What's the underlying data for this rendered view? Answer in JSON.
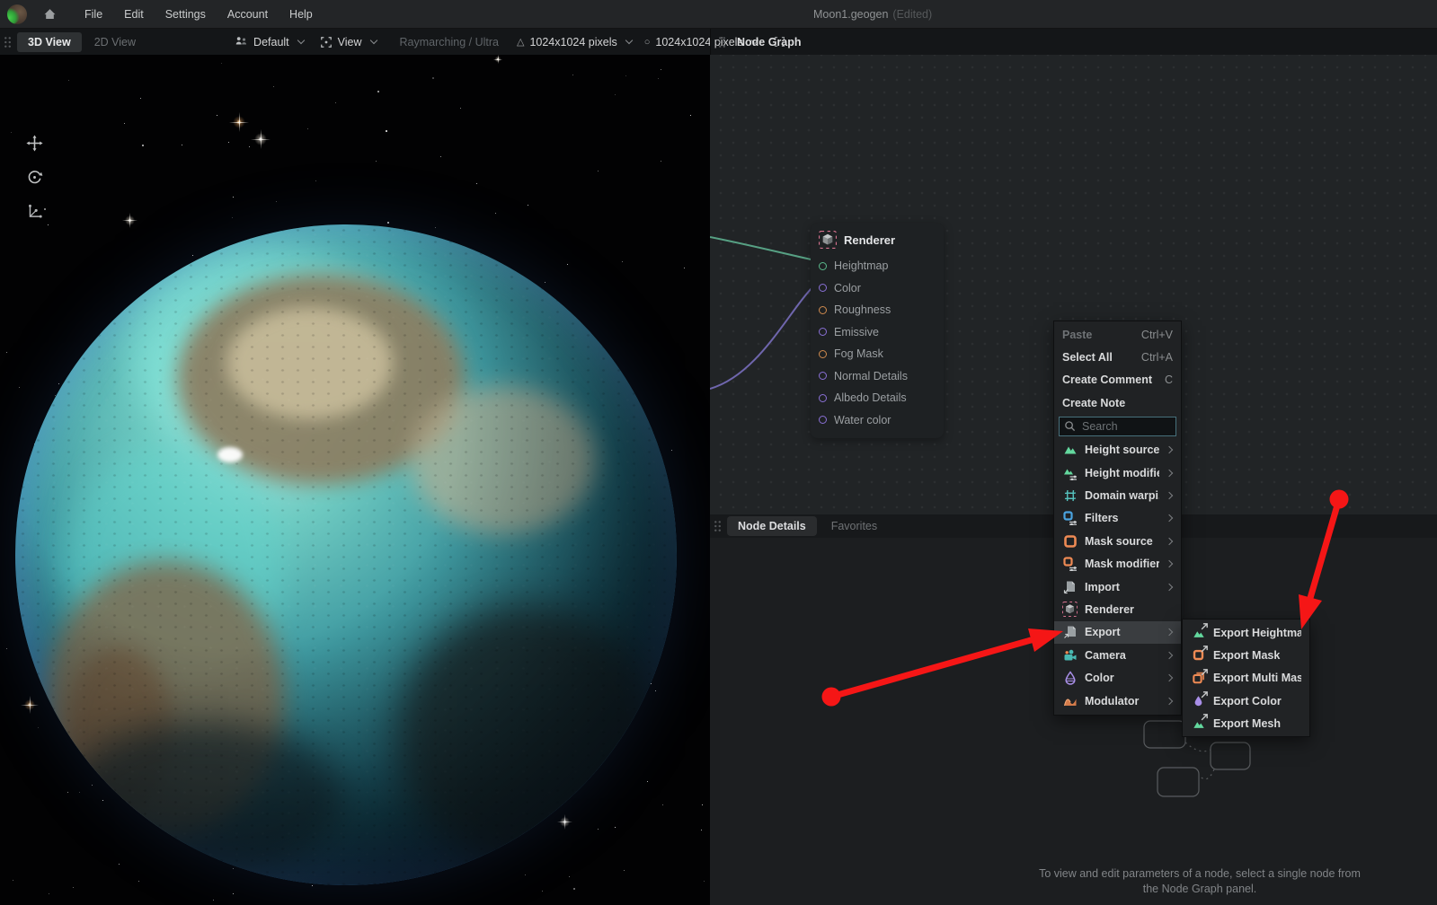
{
  "window": {
    "app_title": "Moon1.geogen",
    "edited_suffix": "(Edited)"
  },
  "menubar": {
    "items": [
      "File",
      "Edit",
      "Settings",
      "Account",
      "Help"
    ]
  },
  "toolbar": {
    "tabs": [
      {
        "label": "3D View"
      },
      {
        "label": "2D View"
      }
    ],
    "preset": "Default",
    "view": "View",
    "render_mode": "Raymarching / Ultra",
    "heightmap_resolution": "1024x1024 pixels",
    "texture_resolution": "1024x1024 pixels",
    "node_graph_title": "Node Graph"
  },
  "renderer_node": {
    "title": "Renderer",
    "ports": [
      {
        "label": "Heightmap",
        "color": "#5ab98b"
      },
      {
        "label": "Color",
        "color": "#8a70d6"
      },
      {
        "label": "Roughness",
        "color": "#cf8a4e"
      },
      {
        "label": "Emissive",
        "color": "#8a70d6"
      },
      {
        "label": "Fog Mask",
        "color": "#cf8a4e"
      },
      {
        "label": "Normal Details",
        "color": "#8a70d6"
      },
      {
        "label": "Albedo Details",
        "color": "#8a70d6"
      },
      {
        "label": "Water color",
        "color": "#8a70d6"
      }
    ]
  },
  "context_menu": {
    "actions": [
      {
        "label": "Paste",
        "shortcut": "Ctrl+V",
        "disabled": true
      },
      {
        "label": "Select All",
        "shortcut": "Ctrl+A",
        "disabled": false
      },
      {
        "label": "Create Comment",
        "shortcut": "C",
        "disabled": false
      },
      {
        "label": "Create Note",
        "shortcut": "",
        "disabled": false
      }
    ],
    "search_placeholder": "Search",
    "categories": [
      {
        "label": "Height source",
        "submenu": true
      },
      {
        "label": "Height modifier",
        "submenu": true
      },
      {
        "label": "Domain warpi...",
        "submenu": true
      },
      {
        "label": "Filters",
        "submenu": true
      },
      {
        "label": "Mask source",
        "submenu": true
      },
      {
        "label": "Mask modifier",
        "submenu": true
      },
      {
        "label": "Import",
        "submenu": true
      },
      {
        "label": "Renderer",
        "submenu": false
      },
      {
        "label": "Export",
        "submenu": true,
        "highlighted": true
      },
      {
        "label": "Camera",
        "submenu": true
      },
      {
        "label": "Color",
        "submenu": true
      },
      {
        "label": "Modulator",
        "submenu": true
      }
    ]
  },
  "export_submenu": {
    "items": [
      {
        "label": "Export Heightmap"
      },
      {
        "label": "Export Mask"
      },
      {
        "label": "Export Multi Masks"
      },
      {
        "label": "Export Color"
      },
      {
        "label": "Export Mesh"
      }
    ]
  },
  "node_details": {
    "tabs": [
      "Node Details",
      "Favorites"
    ],
    "empty_hint": "To view and edit parameters of a node, select a single node from the Node Graph panel."
  },
  "colors": {
    "accent_green": "#63d89e",
    "accent_teal": "#56c4c0",
    "accent_blue": "#4aa3e0",
    "accent_orange": "#ee8a54",
    "accent_purple": "#a98fe8",
    "selection_pink": "#d6728f",
    "arrow_red": "#f51616",
    "search_border": "#47707b"
  }
}
